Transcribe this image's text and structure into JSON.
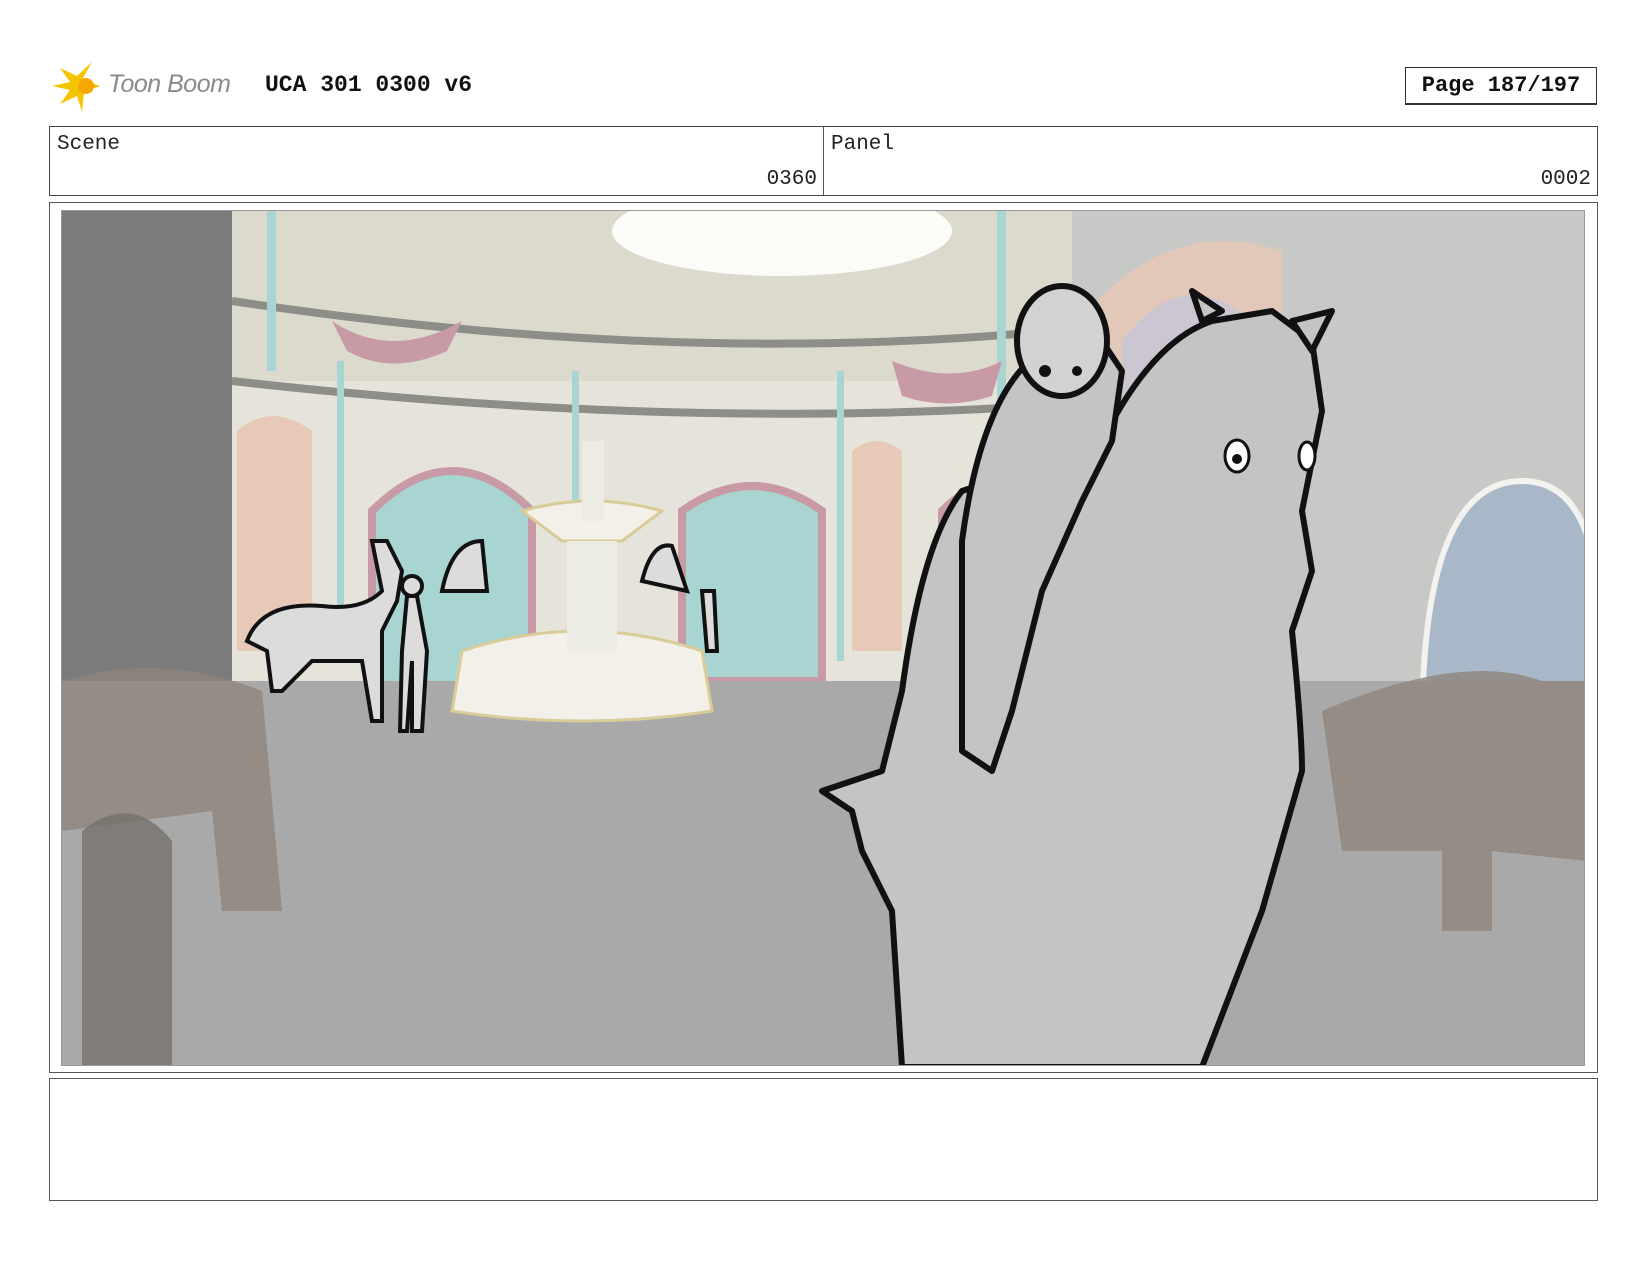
{
  "header": {
    "logo_text": "Toon Boom",
    "project_title": "UCA 301 0300 v6",
    "page_label": "Page 187/197"
  },
  "info": {
    "scene_label": "Scene",
    "scene_value": "0360",
    "panel_label": "Panel",
    "panel_value": "0002"
  },
  "colors": {
    "logo_star": "#f5c400",
    "floor": "#a9a9a9",
    "wall": "#e8e6dc",
    "teal": "#a8d4d2",
    "pink": "#c79aa6"
  }
}
